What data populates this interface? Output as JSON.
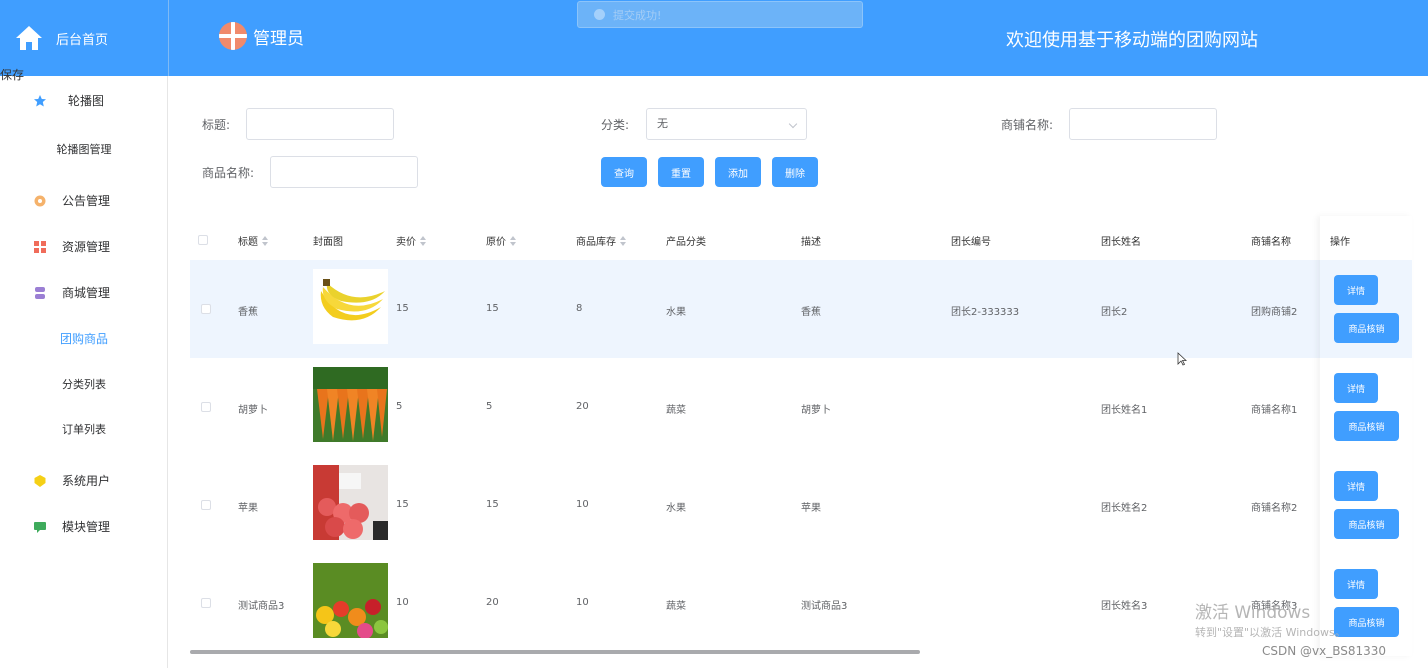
{
  "sidebar_header": {
    "home_label": "后台首页"
  },
  "topbar": {
    "admin_name": "管理员",
    "welcome": "欢迎使用基于移动端的团购网站",
    "toast": "提交成功!"
  },
  "ghost_text": "保存",
  "sidebar": {
    "carousel_group": "轮播图",
    "carousel_manage": "轮播图管理",
    "notice": "公告管理",
    "resource": "资源管理",
    "mall": "商城管理",
    "groupbuy": "团购商品",
    "category": "分类列表",
    "orders": "订单列表",
    "users": "系统用户",
    "modules": "模块管理"
  },
  "search": {
    "title_label": "标题:",
    "title_value": "",
    "category_label": "分类:",
    "category_value": "无",
    "shop_label": "商铺名称:",
    "shop_value": "",
    "product_label": "商品名称:",
    "product_value": ""
  },
  "buttons": {
    "query": "查询",
    "reset": "重置",
    "add": "添加",
    "delete": "删除"
  },
  "table": {
    "headers": {
      "title": "标题",
      "cover": "封面图",
      "price": "卖价",
      "original": "原价",
      "stock": "商品库存",
      "category": "产品分类",
      "desc": "描述",
      "leader_no": "团长编号",
      "leader_name": "团长姓名",
      "shop": "商铺名称",
      "ops": "操作"
    },
    "rows": [
      {
        "title": "香蕉",
        "cover": "banana-image",
        "price": "15",
        "original": "15",
        "stock": "8",
        "category": "水果",
        "desc": "香蕉",
        "leader_no": "团长2-333333",
        "leader_name": "团长2",
        "shop": "团购商铺2"
      },
      {
        "title": "胡萝卜",
        "cover": "carrot-image",
        "price": "5",
        "original": "5",
        "stock": "20",
        "category": "蔬菜",
        "desc": "胡萝卜",
        "leader_no": "",
        "leader_name": "团长姓名1",
        "shop": "商铺名称1"
      },
      {
        "title": "苹果",
        "cover": "apple-image",
        "price": "15",
        "original": "15",
        "stock": "10",
        "category": "水果",
        "desc": "苹果",
        "leader_no": "",
        "leader_name": "团长姓名2",
        "shop": "商铺名称2"
      },
      {
        "title": "测试商品3",
        "cover": "fruit-mix-image",
        "price": "10",
        "original": "20",
        "stock": "10",
        "category": "蔬菜",
        "desc": "测试商品3",
        "leader_no": "",
        "leader_name": "团长姓名3",
        "shop": "商铺名称3"
      }
    ],
    "op_detail": "详情",
    "op_verify": "商品核销"
  },
  "overlay": {
    "windows_activate": "激活 Windows",
    "windows_hint": "转到\"设置\"以激活 Windows。",
    "csdn": "CSDN @vx_BS81330"
  },
  "colors": {
    "primary": "#409eff",
    "row_highlight": "#eef5fe"
  }
}
